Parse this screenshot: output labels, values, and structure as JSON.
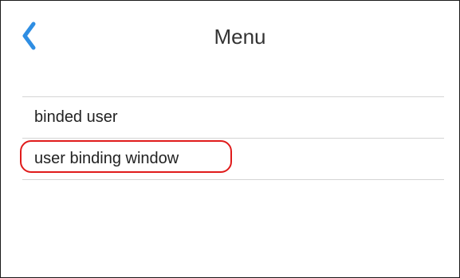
{
  "header": {
    "title": "Menu",
    "back_icon": "chevron-left-icon",
    "back_icon_color": "#2f8ee3"
  },
  "menu": {
    "items": [
      {
        "label": "binded user",
        "highlighted": false
      },
      {
        "label": "user binding window",
        "highlighted": true
      }
    ]
  },
  "colors": {
    "accent": "#2f8ee3",
    "highlight": "#e01b1b",
    "divider": "#d4d4d4"
  }
}
